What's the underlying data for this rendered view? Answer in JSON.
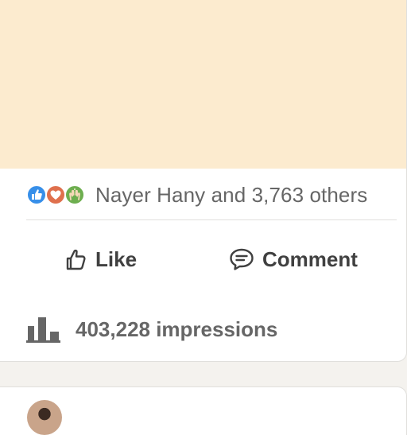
{
  "post": {
    "reactions": {
      "icons": [
        "like-icon",
        "love-icon",
        "celebrate-icon"
      ],
      "text": "Nayer Hany and 3,763 others"
    },
    "actions": {
      "like_label": "Like",
      "comment_label": "Comment"
    },
    "impressions_text": "403,228 impressions"
  },
  "colors": {
    "media_background": "#fcebcf",
    "like_reaction": "#378fe9",
    "love_reaction": "#df704d",
    "celebrate_reaction": "#6dae4f",
    "text_secondary": "#666666",
    "text_action": "#404040"
  }
}
